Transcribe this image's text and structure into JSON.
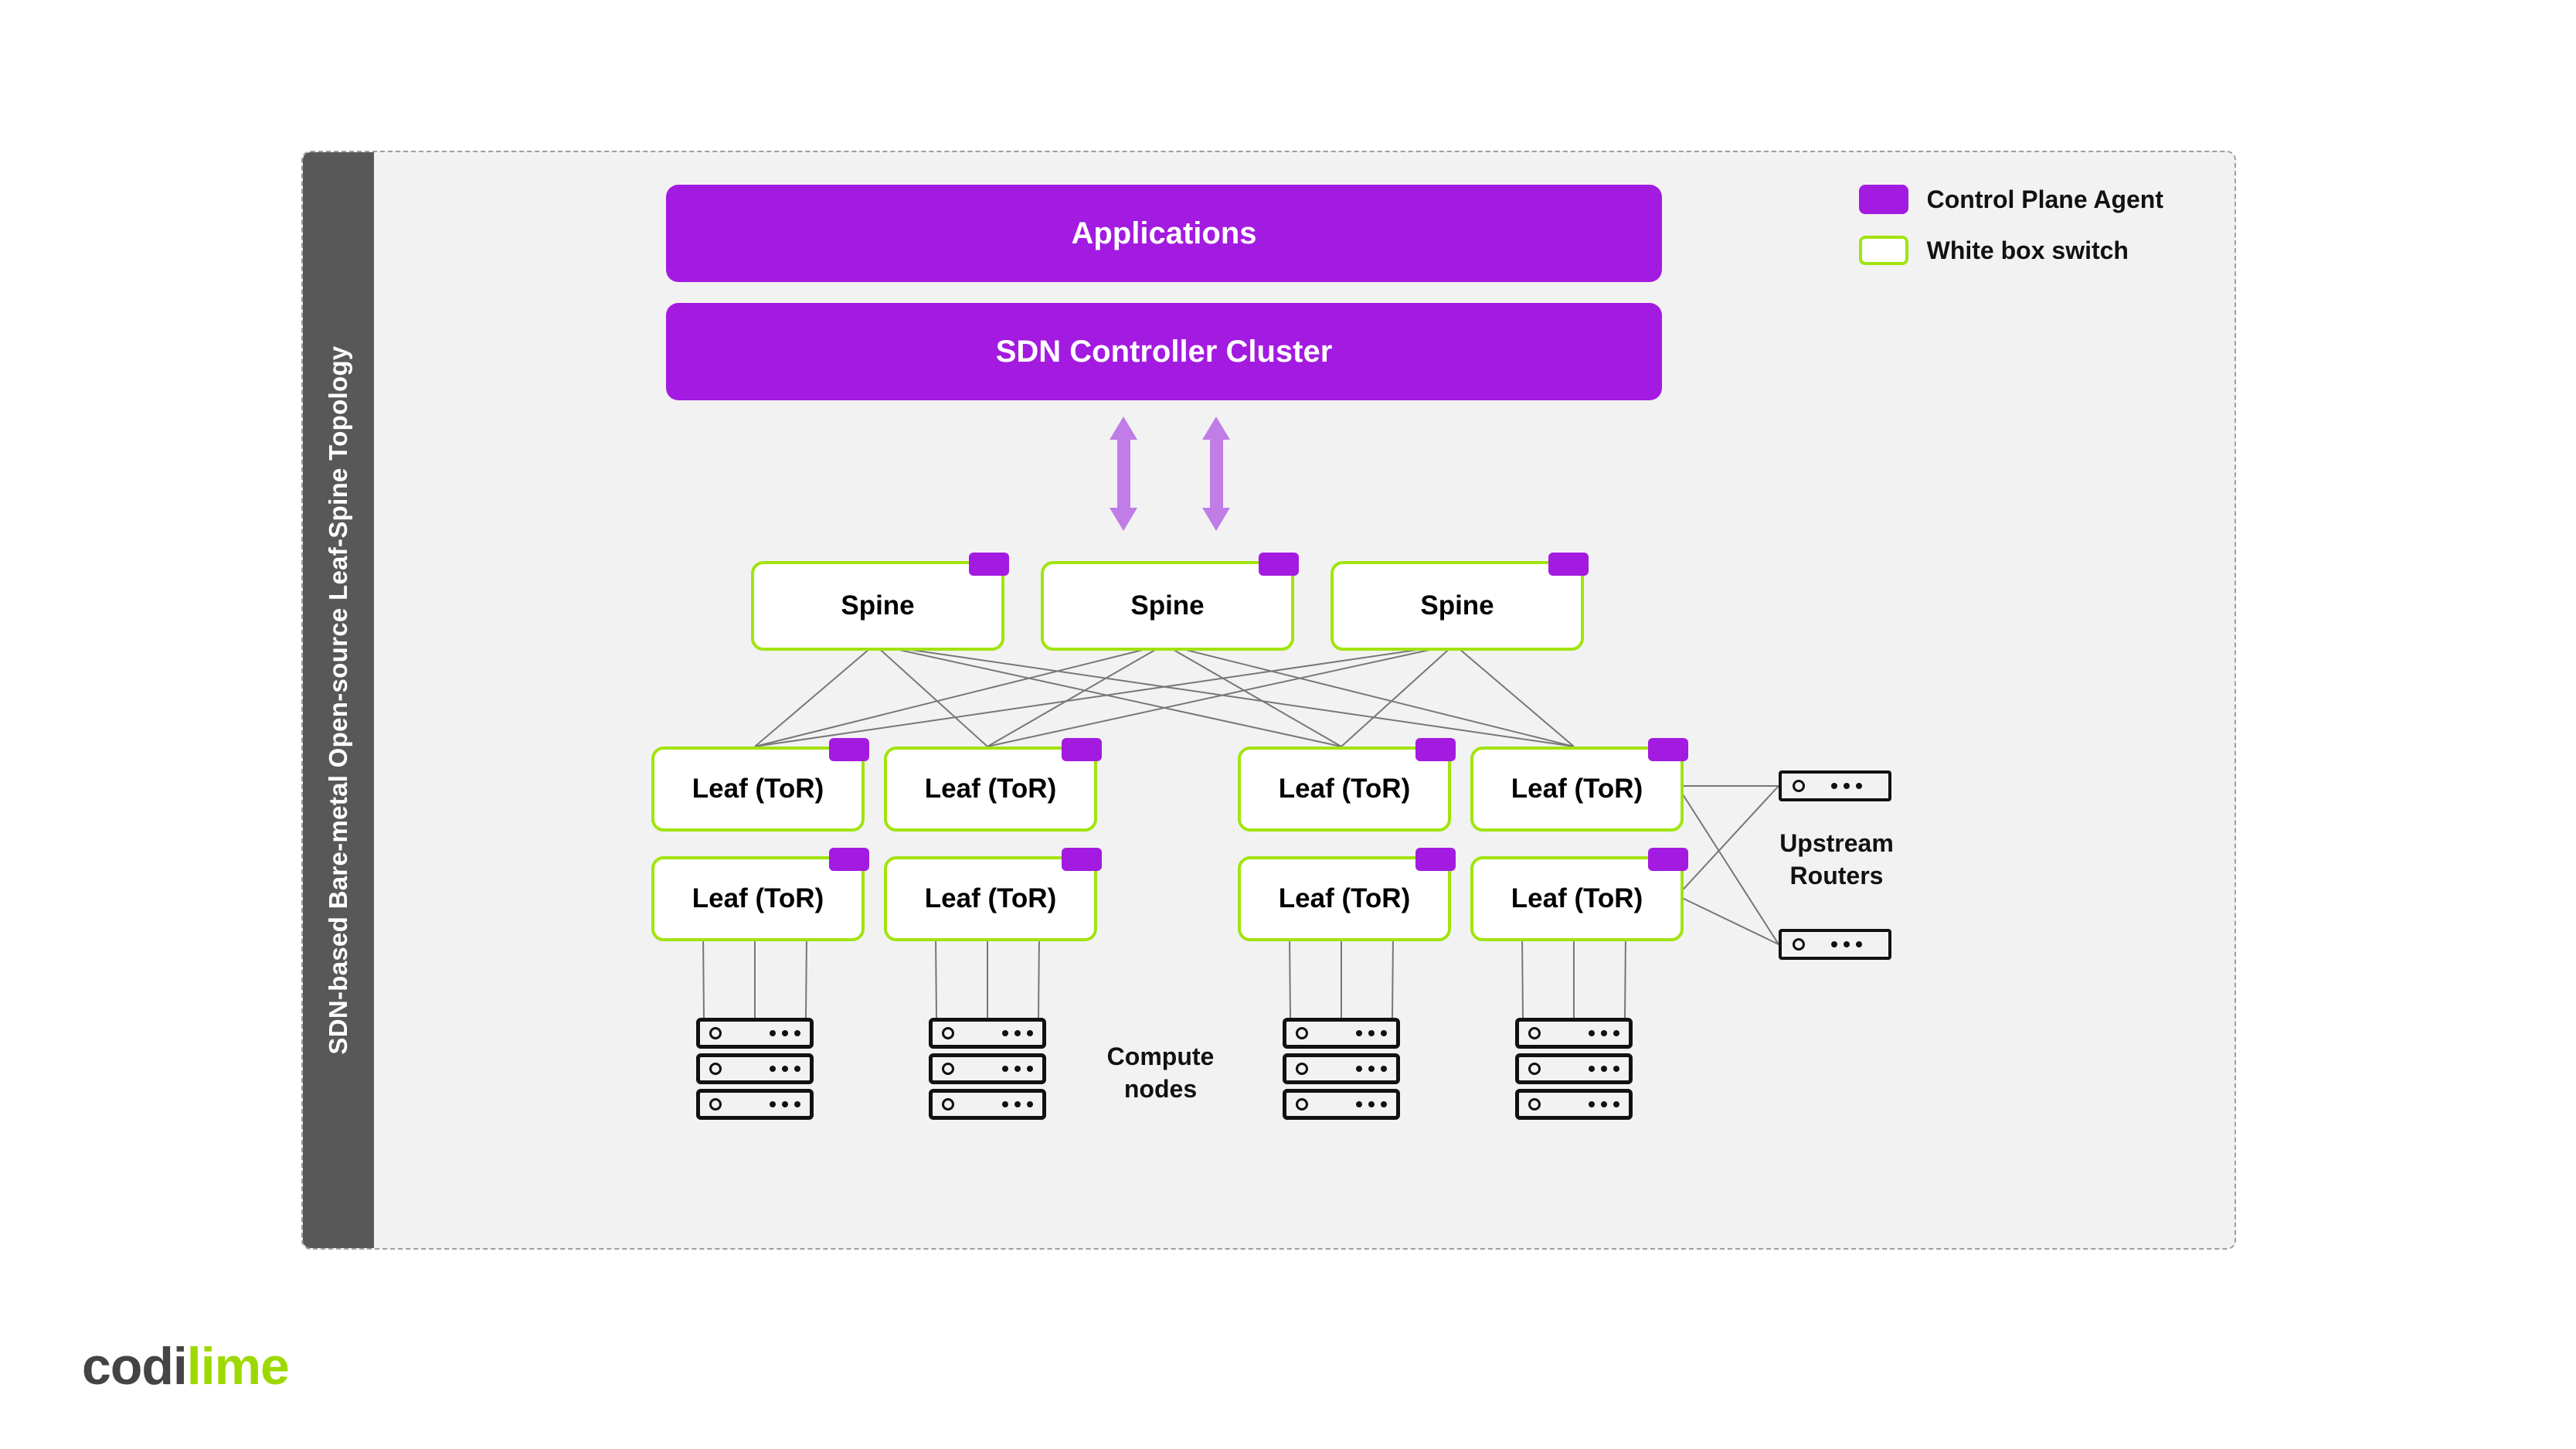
{
  "sidebar_title": "SDN-based Bare-metal Open-source Leaf-Spine Topology",
  "wide_boxes": {
    "applications": "Applications",
    "sdn_controller": "SDN Controller Cluster"
  },
  "legend": {
    "control_plane_agent": "Control Plane Agent",
    "white_box_switch": "White box switch"
  },
  "spines": [
    "Spine",
    "Spine",
    "Spine"
  ],
  "leaf_rows": [
    [
      "Leaf (ToR)",
      "Leaf (ToR)",
      "Leaf (ToR)",
      "Leaf (ToR)"
    ],
    [
      "Leaf (ToR)",
      "Leaf (ToR)",
      "Leaf (ToR)",
      "Leaf (ToR)"
    ]
  ],
  "labels": {
    "upstream_routers": "Upstream\nRouters",
    "compute_nodes": "Compute\nnodes"
  },
  "logo": {
    "codi": "codi",
    "lime": "lime"
  },
  "colors": {
    "purple": "#a31be0",
    "green": "#a1e40e",
    "arrow": "#c07de6"
  }
}
